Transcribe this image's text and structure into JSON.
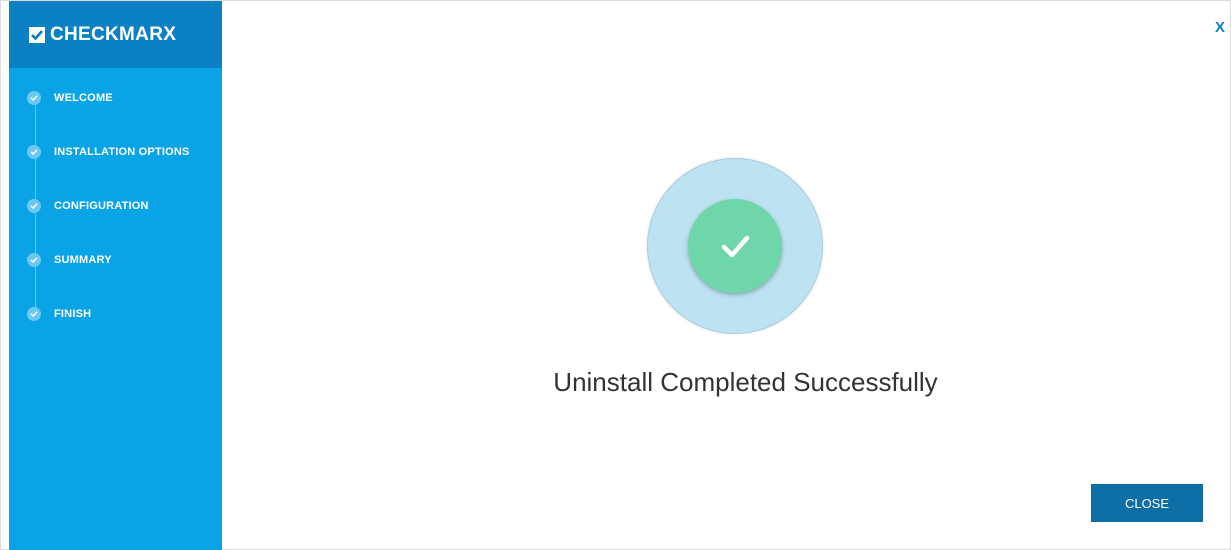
{
  "brand": {
    "name": "CHECKMARX",
    "logo_icon": "checkmark-square-icon"
  },
  "sidebar": {
    "steps": [
      {
        "label": "WELCOME",
        "icon": "check-icon",
        "done": true
      },
      {
        "label": "INSTALLATION OPTIONS",
        "icon": "check-icon",
        "done": true
      },
      {
        "label": "CONFIGURATION",
        "icon": "check-icon",
        "done": true
      },
      {
        "label": "SUMMARY",
        "icon": "check-icon",
        "done": true
      },
      {
        "label": "FINISH",
        "icon": "check-icon",
        "done": true
      }
    ]
  },
  "window": {
    "close_label": "X"
  },
  "main": {
    "status_icon": "success-check-icon",
    "message": "Uninstall Completed Successfully",
    "close_button_label": "CLOSE"
  },
  "colors": {
    "sidebar_bg": "#0aa3e6",
    "logo_bar_bg": "#0b80c2",
    "success_green": "#6fd6a9",
    "success_ring": "#bde3f3",
    "button_bg": "#0e6fa6"
  }
}
